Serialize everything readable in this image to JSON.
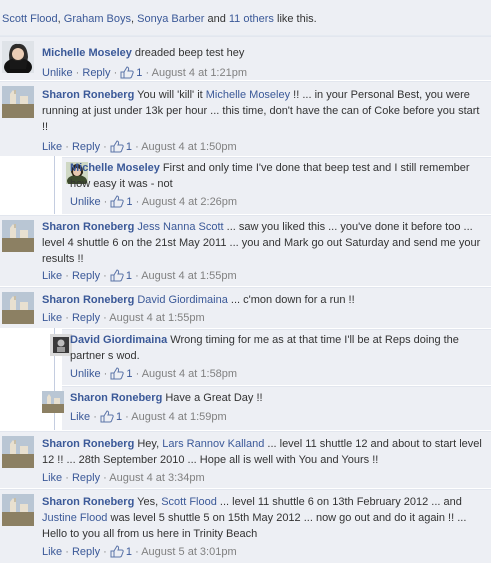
{
  "likes_bar": {
    "names": [
      "Scott Flood",
      "Graham Boys",
      "Sonya Barber"
    ],
    "sep1": ", ",
    "sep2": ", ",
    "and": " and ",
    "others": "11 others",
    "suffix": " like this."
  },
  "actions": {
    "like": "Like",
    "unlike": "Unlike",
    "reply": "Reply",
    "dot": "·"
  },
  "colors": {
    "link": "#3b5998",
    "comment_bg": "#edeff4",
    "timestamp": "#808080"
  },
  "comments": [
    {
      "author": "Michelle Moseley",
      "parts": [
        " dreaded beep test hey"
      ],
      "action": "Unlike",
      "likes": "1",
      "time": "August 4 at 1:21pm"
    },
    {
      "author": "Sharon Roneberg",
      "parts": [
        " You will 'kill' it ",
        "Michelle Moseley",
        " !! ... in your Personal Best, you were running at just under 13k per hour ... this time, don't have the can of Coke before you start !!"
      ],
      "action": "Like",
      "likes": "1",
      "time": "August 4 at 1:50pm"
    },
    {
      "author": "Michelle Moseley",
      "parts": [
        " First and only time I've done that beep test and I still remember how easy it was - not"
      ],
      "action": "Unlike",
      "likes": "1",
      "time": "August 4 at 2:26pm"
    },
    {
      "author": "Sharon Roneberg",
      "parts": [
        " ",
        "Jess Nanna Scott",
        " ... saw you liked this ... you've done it before too ... level 4 shuttle 6 on the 21st May 2011 ... you and Mark go out Saturday and send me your results !!"
      ],
      "action": "Like",
      "likes": "1",
      "time": "August 4 at 1:55pm"
    },
    {
      "author": "Sharon Roneberg",
      "parts": [
        " ",
        "David Giordimaina",
        " ... c'mon down for a run !!"
      ],
      "action": "Like",
      "likes": "",
      "time": "August 4 at 1:55pm"
    },
    {
      "author": "David Giordimaina",
      "parts": [
        " Wrong timing for me as at that time I'll be at Reps doing the partner s wod."
      ],
      "action": "Unlike",
      "likes": "1",
      "time": "August 4 at 1:58pm"
    },
    {
      "author": "Sharon Roneberg",
      "parts": [
        " Have a Great Day !!"
      ],
      "action": "Like",
      "likes": "1",
      "time": "August 4 at 1:59pm"
    },
    {
      "author": "Sharon Roneberg",
      "parts": [
        " Hey, ",
        "Lars Rannov Kalland",
        " ... level 11 shuttle 12 and about to start level 12 !! ... 28th September 2010 ... Hope all is well with You and Yours !!"
      ],
      "action": "Like",
      "likes": "",
      "time": "August 4 at 3:34pm"
    },
    {
      "author": "Sharon Roneberg",
      "parts": [
        " Yes, ",
        "Scott Flood",
        " ... level 11 shuttle 6 on 13th February 2012 ... and ",
        "Justine Flood",
        " was level 5 shuttle 5 on 15th May 2012 ... now go out and do it again !! ... Hello to you all from us here in Trinity Beach"
      ],
      "action": "Like",
      "likes": "1",
      "time": "August 5 at 3:01pm"
    }
  ]
}
